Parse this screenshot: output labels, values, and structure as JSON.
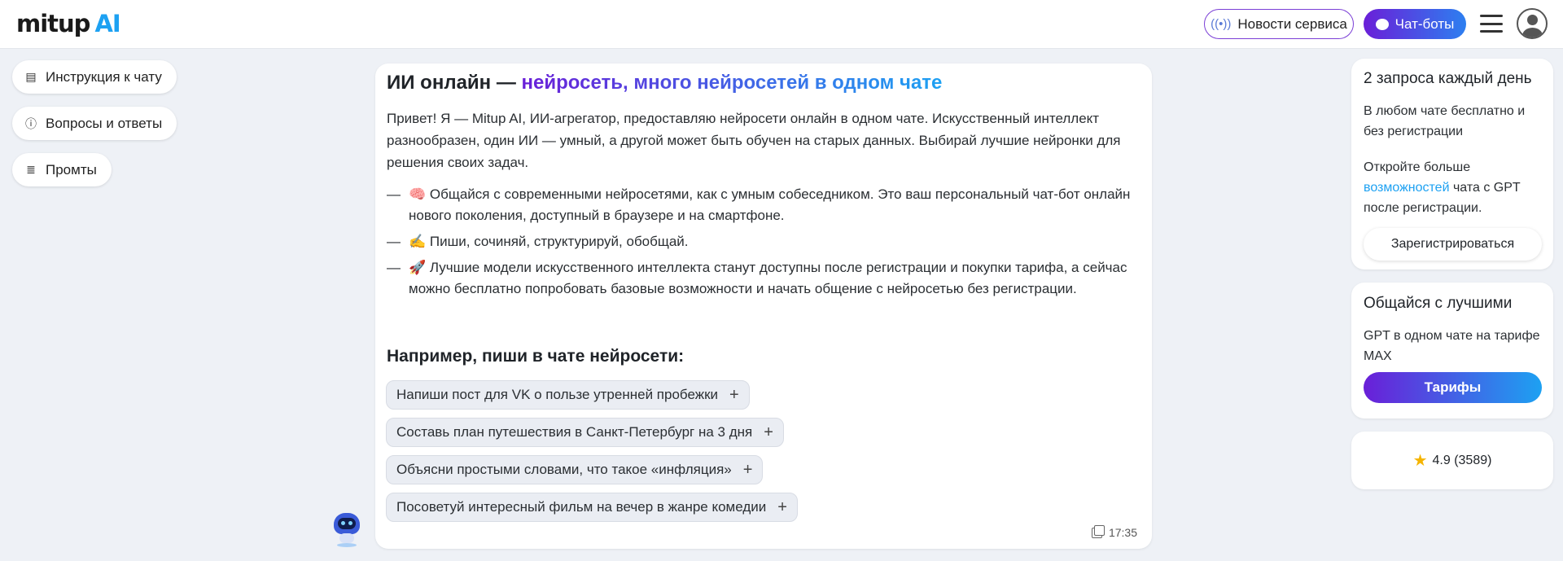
{
  "header": {
    "logo_main": "mitup",
    "logo_ai": "AI",
    "news_label": "Новости сервиса",
    "chatbots_label": "Чат-боты"
  },
  "left_nav": {
    "items": [
      {
        "label": "Инструкция к чату",
        "icon": "list-icon"
      },
      {
        "label": "Вопросы и ответы",
        "icon": "question-icon"
      },
      {
        "label": "Промты",
        "icon": "database-icon"
      }
    ]
  },
  "card": {
    "title_plain": "ИИ онлайн — ",
    "title_highlight": "нейросеть, много нейросетей в одном чате",
    "intro": "Привет! Я — Mitup AI, ИИ-агрегатор, предоставляю нейросети онлайн в одном чате. Искусственный интеллект разнообразен, один ИИ — умный, а другой может быть обучен на старых данных. Выбирай лучшие нейронки для решения своих задач.",
    "bullets": [
      {
        "emoji": "🧠",
        "text": "Общайся с современными нейросетями, как с умным собеседником. Это ваш персональный чат-бот онлайн нового поколения, доступный в браузере и на смартфоне."
      },
      {
        "emoji": "✍️",
        "text": "Пиши, сочиняй, структурируй, обобщай."
      },
      {
        "emoji": "🚀",
        "text": "Лучшие модели искусственного интеллекта станут доступны после регистрации и покупки тарифа, а сейчас можно бесплатно попробовать базовые возможности и начать общение с нейросетью без регистрации."
      }
    ],
    "example_title": "Например, пиши в чате нейросети:",
    "examples": [
      "Напиши пост для VK о пользе утренней пробежки",
      "Составь план путешествия в Санкт-Петербург на 3 дня",
      "Объясни простыми словами, что такое «инфляция»",
      "Посоветуй интересный фильм на вечер в жанре комедии"
    ],
    "time": "17:35"
  },
  "sidebar": {
    "free_card": {
      "title": "2 запроса каждый день",
      "text1": "В любом чате бесплатно и без регистрации",
      "text2_before": "Откройте больше ",
      "text2_link": "возможностей",
      "text2_after": " чата с GPT после регистрации.",
      "register_label": "Зарегистрироваться"
    },
    "best_card": {
      "title": "Общайся с лучшими",
      "text": "GPT в одном чате на тарифе MAX",
      "tariffs_label": "Тарифы"
    },
    "rating": {
      "value": "4.9 (3589)"
    }
  },
  "colors": {
    "accent_purple": "#6a1fd8",
    "accent_blue": "#1da1f2",
    "background": "#eef1f6"
  }
}
